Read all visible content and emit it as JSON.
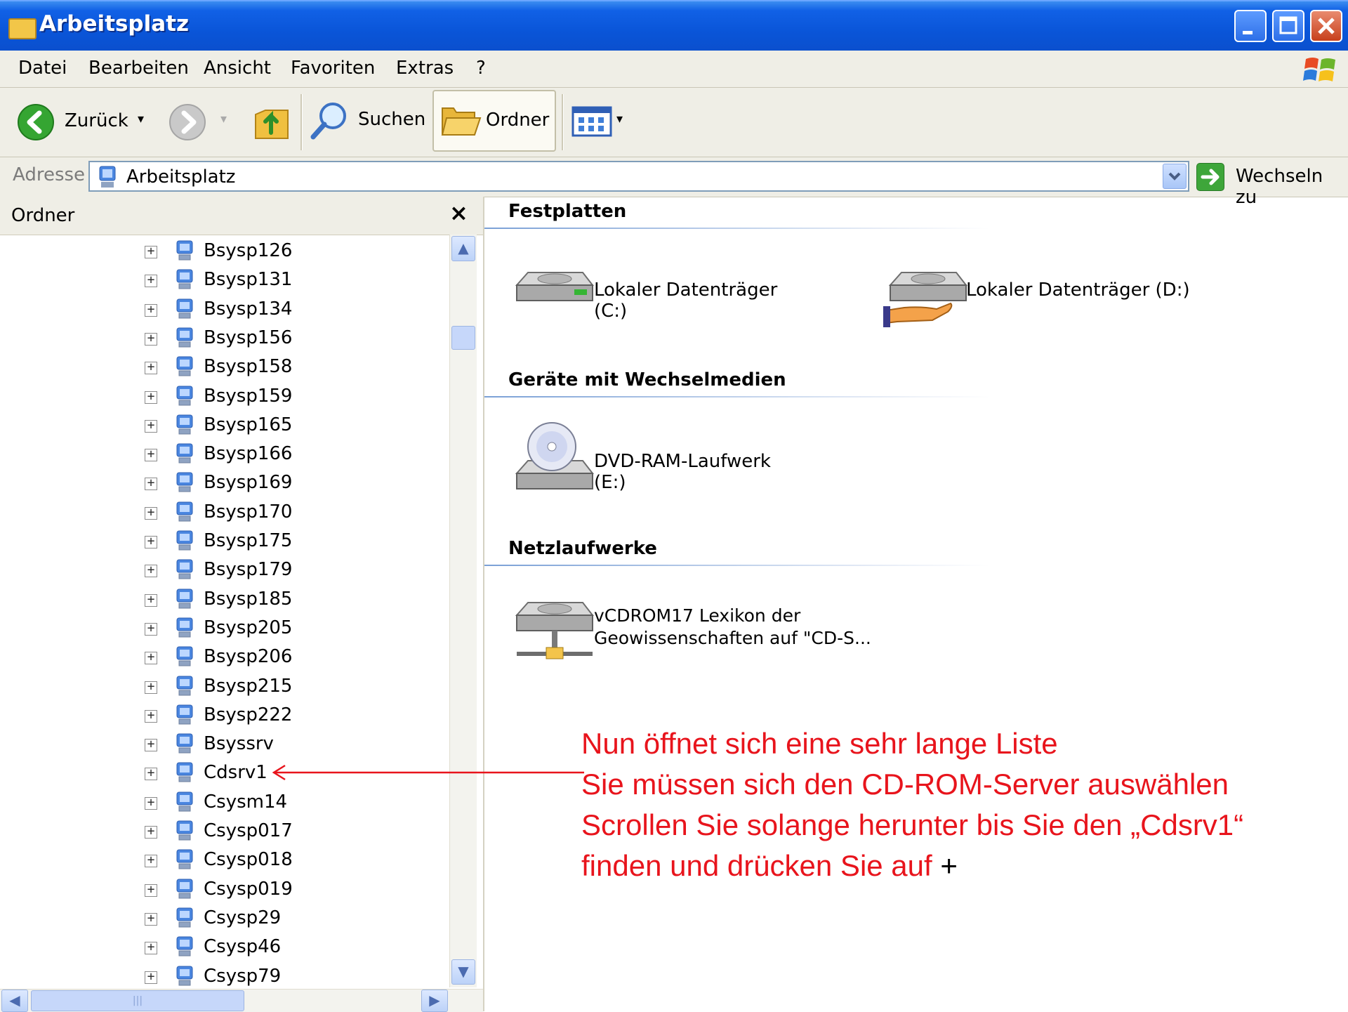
{
  "window": {
    "title": "Arbeitsplatz"
  },
  "menu": {
    "items": [
      "Datei",
      "Bearbeiten",
      "Ansicht",
      "Favoriten",
      "Extras",
      "?"
    ]
  },
  "toolbar": {
    "back_label": "Zurück",
    "search_label": "Suchen",
    "folders_label": "Ordner"
  },
  "address": {
    "label": "Adresse",
    "value": "Arbeitsplatz",
    "go_label": "Wechseln zu"
  },
  "folder_pane": {
    "title": "Ordner",
    "close_glyph": "×",
    "items": [
      "Bsysp126",
      "Bsysp131",
      "Bsysp134",
      "Bsysp156",
      "Bsysp158",
      "Bsysp159",
      "Bsysp165",
      "Bsysp166",
      "Bsysp169",
      "Bsysp170",
      "Bsysp175",
      "Bsysp179",
      "Bsysp185",
      "Bsysp205",
      "Bsysp206",
      "Bsysp215",
      "Bsysp222",
      "Bsyssrv",
      "Cdsrv1",
      "Csysm14",
      "Csysp017",
      "Csysp018",
      "Csysp019",
      "Csysp29",
      "Csysp46",
      "Csysp79"
    ]
  },
  "content": {
    "groups": [
      {
        "title": "Festplatten",
        "items": [
          "Lokaler Datenträger (C:)",
          "Lokaler Datenträger (D:)"
        ]
      },
      {
        "title": "Geräte mit Wechselmedien",
        "items": [
          "DVD-RAM-Laufwerk (E:)"
        ]
      },
      {
        "title": "Netzlaufwerke",
        "items": [
          "vCDROM17 Lexikon der",
          "Geowissenschaften auf \"CD-S..."
        ]
      }
    ]
  },
  "annotation": {
    "lines": [
      "Nun öffnet sich eine sehr lange Liste",
      "Sie müssen sich den CD-ROM-Server auswählen",
      "Scrollen Sie solange herunter bis Sie den „Cdsrv1“",
      "finden und drücken Sie auf "
    ],
    "plus": "+",
    "color": "#e8141c"
  }
}
